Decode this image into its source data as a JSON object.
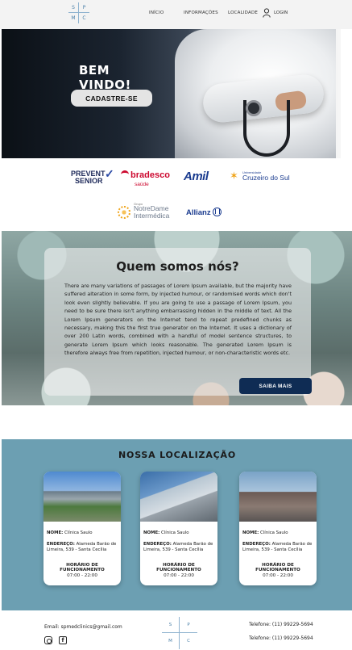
{
  "header": {
    "logo_letters": [
      "S",
      "P",
      "M",
      "C"
    ],
    "nav": [
      "INÍCIO",
      "INFORMAÇÕES",
      "LOCALIDADE"
    ],
    "login": "LOGIN"
  },
  "hero": {
    "title": "BEM VINDO!",
    "button": "CADASTRE-SE"
  },
  "partners": {
    "prevent": [
      "PREVENT",
      "SENIOR"
    ],
    "bradesco": {
      "name": "bradesco",
      "sub": "saúde"
    },
    "amil": "Amil",
    "cruzeiro": {
      "top": "Universidade",
      "name": "Cruzeiro do Sul"
    },
    "notredame": {
      "top": "Grupo",
      "line1": "NotreDame",
      "line2": "Intermédica"
    },
    "allianz": "Allianz"
  },
  "about": {
    "title": "Quem somos nós?",
    "text": "There are many variations of passages of Lorem Ipsum available, but the majority have suffered alteration in some form, by injected humour, or randomised words which don't look even slightly believable. If you are going to use a passage of Lorem Ipsum, you need to be sure there isn't anything embarrassing hidden in the middle of text. All the Lorem Ipsum generators on the Internet tend to repeat predefined chunks as necessary, making this the first true generator on the Internet. It uses a dictionary of over 200 Latin words, combined with a handful of model sentence structures, to generate Lorem Ipsum which looks reasonable. The generated Lorem Ipsum is therefore always free from repetition, injected humour, or non-characteristic words etc.",
    "button": "SAIBA MAIS"
  },
  "locations": {
    "title": "NOSSA LOCALIZAÇÃO",
    "cards": [
      {
        "name_label": "NOME:",
        "name": "Clínica Saulo",
        "addr_label": "ENDEREÇO:",
        "addr": "Alameda Barão de Limeira, 539 - Santa Cecília",
        "hours_label": "HORÁRIO DE FUNCIONAMENTO",
        "hours": "07:00 - 22:00"
      },
      {
        "name_label": "NOME:",
        "name": "Clínica Saulo",
        "addr_label": "ENDEREÇO:",
        "addr": "Alameda Barão de Limeira, 539 - Santa Cecília",
        "hours_label": "HORÁRIO DE FUNCIONAMENTO",
        "hours": "07:00 - 22:00"
      },
      {
        "name_label": "NOME:",
        "name": "Clínica Saulo",
        "addr_label": "ENDEREÇO:",
        "addr": "Alameda Barão de Limeira, 539 - Santa Cecília",
        "hours_label": "HORÁRIO DE FUNCIONAMENTO",
        "hours": "07:00 - 22:00"
      }
    ]
  },
  "footer": {
    "email": "Email: spmedclinics@gmail.com",
    "logo_letters": [
      "S",
      "P",
      "M",
      "C"
    ],
    "tel1": "Telefone: (11) 99229-5694",
    "tel2": "Telefone: (11) 99229-5694"
  }
}
